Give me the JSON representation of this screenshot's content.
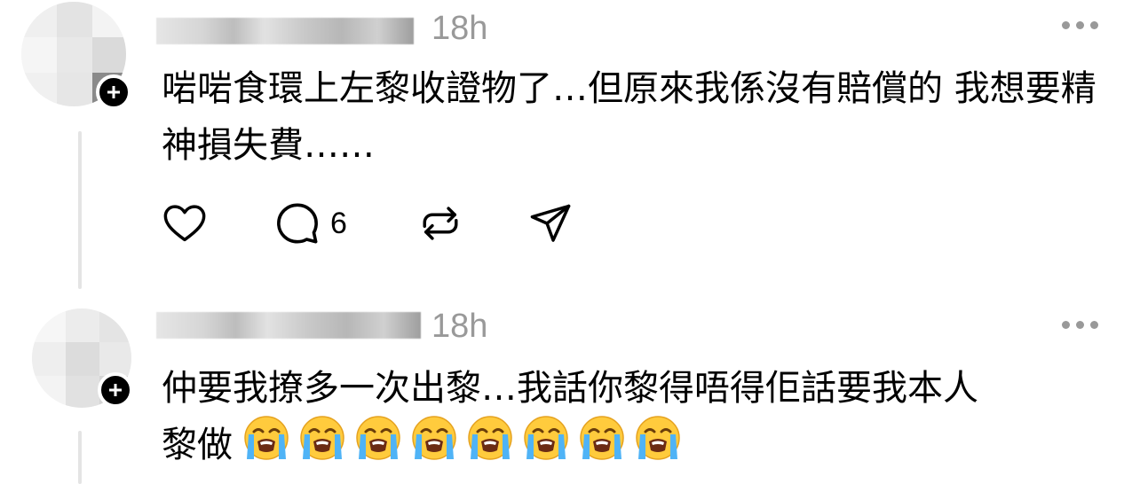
{
  "posts": [
    {
      "timestamp": "18h",
      "text": "啱啱食環上左黎收證物了…但原來我係沒有賠償的 我想要精神損失費……",
      "reply_count": "6"
    },
    {
      "timestamp": "18h",
      "text_line1": "仲要我撩多一次出黎…我話你黎得唔得佢話要我本人",
      "text_line2": "黎做",
      "emoji_count": 8,
      "emoji_name": "loudly-crying-face"
    }
  ],
  "icons": {
    "like": "heart-icon",
    "reply": "comment-icon",
    "repost": "repost-icon",
    "share": "send-icon",
    "more": "more-horizontal-icon",
    "follow": "plus-icon"
  },
  "colors": {
    "text": "#000000",
    "muted": "#999999",
    "thread_line": "#e4e4e4"
  }
}
